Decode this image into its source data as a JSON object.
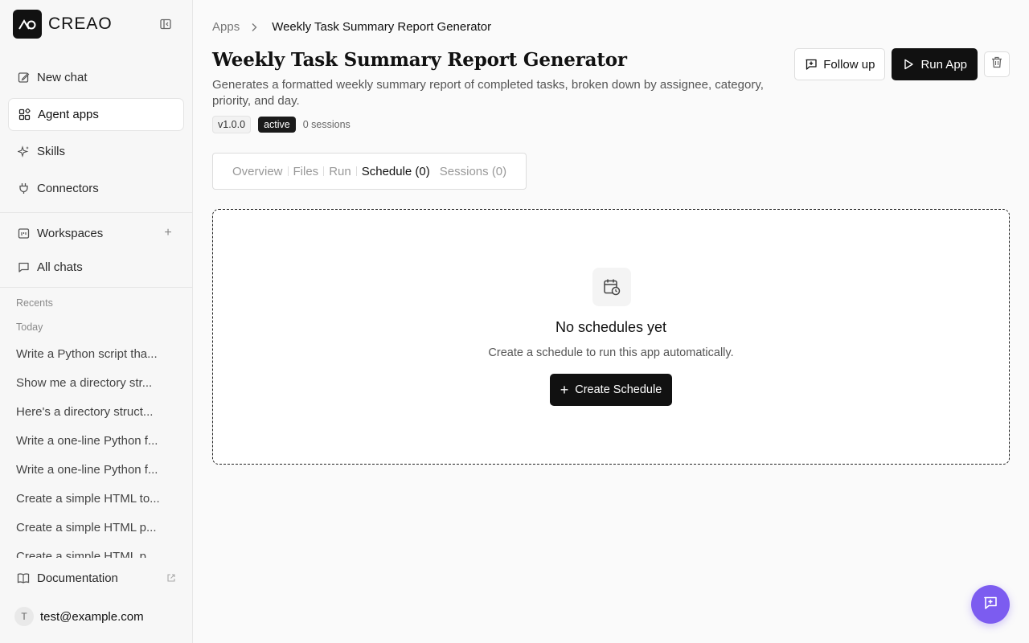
{
  "brand": {
    "name": "CREAO"
  },
  "sidebar": {
    "nav": [
      {
        "label": "New chat",
        "icon": "edit-icon"
      },
      {
        "label": "Agent apps",
        "icon": "apps-icon",
        "active": true
      },
      {
        "label": "Skills",
        "icon": "sparkles-icon"
      },
      {
        "label": "Connectors",
        "icon": "plug-icon"
      }
    ],
    "workspaces_label": "Workspaces",
    "all_chats_label": "All chats",
    "recents_label": "Recents",
    "today_label": "Today",
    "recents": [
      "Write a Python script tha...",
      "Show me a directory str...",
      "Here's a directory struct...",
      "Write a one-line Python f...",
      "Write a one-line Python f...",
      "Create a simple HTML to...",
      "Create a simple HTML p...",
      "Create a simple HTML p..."
    ],
    "documentation_label": "Documentation",
    "user": {
      "initial": "T",
      "email": "test@example.com"
    }
  },
  "breadcrumb": {
    "root": "Apps",
    "current": "Weekly Task Summary Report Generator"
  },
  "page": {
    "title": "Weekly Task Summary Report Generator",
    "description": "Generates a formatted weekly summary report of completed tasks, broken down by assignee, category, priority, and day.",
    "version": "v1.0.0",
    "status": "active",
    "sessions": "0 sessions"
  },
  "actions": {
    "follow_up": "Follow up",
    "run_app": "Run App"
  },
  "tabs": [
    "Overview",
    "Files",
    "Run",
    "Schedule (0)",
    "Sessions (0)"
  ],
  "empty_state": {
    "title": "No schedules yet",
    "subtitle": "Create a schedule to run this app automatically.",
    "button": "Create Schedule"
  },
  "colors": {
    "accent": "#7c5cf0",
    "primary": "#111111"
  }
}
